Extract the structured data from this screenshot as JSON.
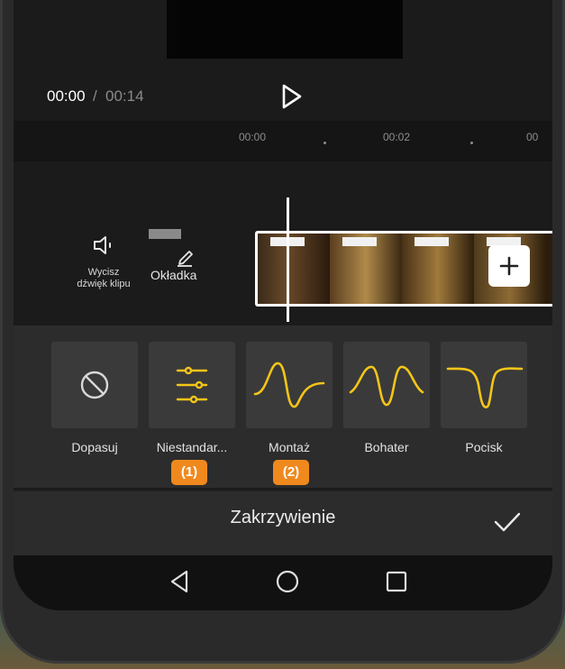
{
  "player": {
    "current_time": "00:00",
    "separator": "/",
    "total_time": "00:14"
  },
  "timeline": {
    "ticks": [
      "00:00",
      "00:02",
      "00"
    ]
  },
  "tools": {
    "mute_label_line1": "Wycisz",
    "mute_label_line2": "dźwięk klipu",
    "cover_label": "Okładka",
    "add_clip_symbol": "+"
  },
  "presets": [
    {
      "label": "Dopasuj",
      "icon": "no-curve-icon"
    },
    {
      "label": "Niestandar...",
      "icon": "sliders-icon",
      "badge": "(1)"
    },
    {
      "label": "Montaż",
      "icon": "montage-curve-icon",
      "badge": "(2)"
    },
    {
      "label": "Bohater",
      "icon": "hero-curve-icon"
    },
    {
      "label": "Pocisk",
      "icon": "bullet-curve-icon"
    }
  ],
  "bottom_bar": {
    "title": "Zakrzywienie"
  },
  "colors": {
    "accent_curve": "#f5c518",
    "badge": "#f0891d"
  }
}
